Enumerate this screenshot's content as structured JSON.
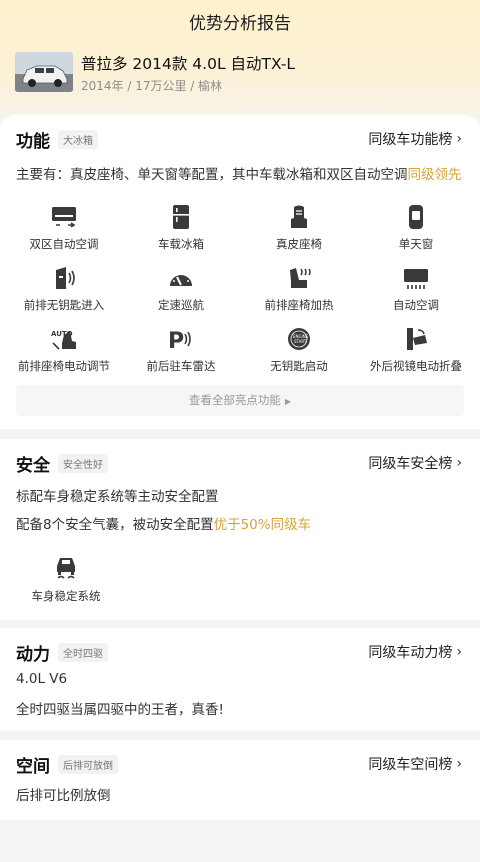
{
  "header": {
    "title": "优势分析报告",
    "car_name": "普拉多 2014款 4.0L 自动TX-L",
    "car_meta": "2014年 / 17万公里 / 榆林"
  },
  "features": {
    "title": "功能",
    "tag": "大冰箱",
    "rank_link": "同级车功能榜",
    "desc_prefix": "主要有：真皮座椅、单天窗等配置，其中车载冰箱和双区自动空调",
    "desc_highlight": "同级领先",
    "items": [
      {
        "label": "双区自动空调",
        "icon": "dual-zone-ac-icon"
      },
      {
        "label": "车载冰箱",
        "icon": "fridge-icon"
      },
      {
        "label": "真皮座椅",
        "icon": "leather-seat-icon"
      },
      {
        "label": "单天窗",
        "icon": "sunroof-icon"
      },
      {
        "label": "前排无钥匙进入",
        "icon": "keyless-entry-icon"
      },
      {
        "label": "定速巡航",
        "icon": "cruise-control-icon"
      },
      {
        "label": "前排座椅加热",
        "icon": "seat-heating-icon"
      },
      {
        "label": "自动空调",
        "icon": "auto-ac-icon"
      },
      {
        "label": "前排座椅电动调节",
        "icon": "power-seat-icon"
      },
      {
        "label": "前后驻车雷达",
        "icon": "parking-radar-icon"
      },
      {
        "label": "无钥匙启动",
        "icon": "keyless-start-icon"
      },
      {
        "label": "外后视镜电动折叠",
        "icon": "mirror-fold-icon"
      }
    ],
    "more_label": "查看全部亮点功能"
  },
  "safety": {
    "title": "安全",
    "tag": "安全性好",
    "rank_link": "同级车安全榜",
    "line1": "标配车身稳定系统等主动安全配置",
    "line2_prefix": "配备8个安全气囊，被动安全配置",
    "line2_highlight": "优于50%同级车",
    "item_label": "车身稳定系统"
  },
  "power": {
    "title": "动力",
    "tag": "全时四驱",
    "rank_link": "同级车动力榜",
    "engine": "4.0L V6",
    "desc": "全时四驱当属四驱中的王者，真香!"
  },
  "space": {
    "title": "空间",
    "tag": "后排可放倒",
    "rank_link": "同级车空间榜",
    "desc": "后排可比例放倒"
  },
  "colors": {
    "highlight": "#d6a43a",
    "icon": "#3a3a3a"
  }
}
